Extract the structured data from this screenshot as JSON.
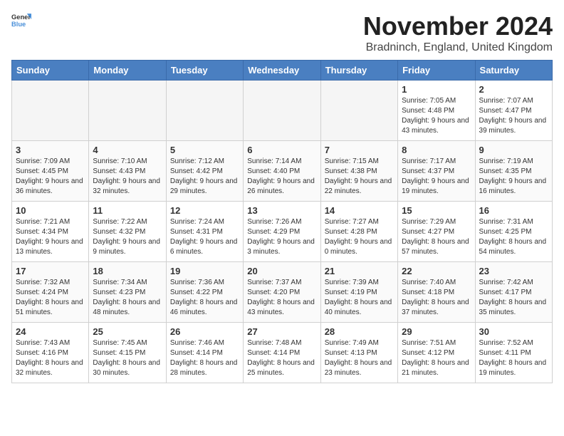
{
  "header": {
    "logo_general": "General",
    "logo_blue": "Blue",
    "month_title": "November 2024",
    "location": "Bradninch, England, United Kingdom"
  },
  "weekdays": [
    "Sunday",
    "Monday",
    "Tuesday",
    "Wednesday",
    "Thursday",
    "Friday",
    "Saturday"
  ],
  "weeks": [
    [
      {
        "day": "",
        "info": ""
      },
      {
        "day": "",
        "info": ""
      },
      {
        "day": "",
        "info": ""
      },
      {
        "day": "",
        "info": ""
      },
      {
        "day": "",
        "info": ""
      },
      {
        "day": "1",
        "info": "Sunrise: 7:05 AM\nSunset: 4:48 PM\nDaylight: 9 hours and 43 minutes."
      },
      {
        "day": "2",
        "info": "Sunrise: 7:07 AM\nSunset: 4:47 PM\nDaylight: 9 hours and 39 minutes."
      }
    ],
    [
      {
        "day": "3",
        "info": "Sunrise: 7:09 AM\nSunset: 4:45 PM\nDaylight: 9 hours and 36 minutes."
      },
      {
        "day": "4",
        "info": "Sunrise: 7:10 AM\nSunset: 4:43 PM\nDaylight: 9 hours and 32 minutes."
      },
      {
        "day": "5",
        "info": "Sunrise: 7:12 AM\nSunset: 4:42 PM\nDaylight: 9 hours and 29 minutes."
      },
      {
        "day": "6",
        "info": "Sunrise: 7:14 AM\nSunset: 4:40 PM\nDaylight: 9 hours and 26 minutes."
      },
      {
        "day": "7",
        "info": "Sunrise: 7:15 AM\nSunset: 4:38 PM\nDaylight: 9 hours and 22 minutes."
      },
      {
        "day": "8",
        "info": "Sunrise: 7:17 AM\nSunset: 4:37 PM\nDaylight: 9 hours and 19 minutes."
      },
      {
        "day": "9",
        "info": "Sunrise: 7:19 AM\nSunset: 4:35 PM\nDaylight: 9 hours and 16 minutes."
      }
    ],
    [
      {
        "day": "10",
        "info": "Sunrise: 7:21 AM\nSunset: 4:34 PM\nDaylight: 9 hours and 13 minutes."
      },
      {
        "day": "11",
        "info": "Sunrise: 7:22 AM\nSunset: 4:32 PM\nDaylight: 9 hours and 9 minutes."
      },
      {
        "day": "12",
        "info": "Sunrise: 7:24 AM\nSunset: 4:31 PM\nDaylight: 9 hours and 6 minutes."
      },
      {
        "day": "13",
        "info": "Sunrise: 7:26 AM\nSunset: 4:29 PM\nDaylight: 9 hours and 3 minutes."
      },
      {
        "day": "14",
        "info": "Sunrise: 7:27 AM\nSunset: 4:28 PM\nDaylight: 9 hours and 0 minutes."
      },
      {
        "day": "15",
        "info": "Sunrise: 7:29 AM\nSunset: 4:27 PM\nDaylight: 8 hours and 57 minutes."
      },
      {
        "day": "16",
        "info": "Sunrise: 7:31 AM\nSunset: 4:25 PM\nDaylight: 8 hours and 54 minutes."
      }
    ],
    [
      {
        "day": "17",
        "info": "Sunrise: 7:32 AM\nSunset: 4:24 PM\nDaylight: 8 hours and 51 minutes."
      },
      {
        "day": "18",
        "info": "Sunrise: 7:34 AM\nSunset: 4:23 PM\nDaylight: 8 hours and 48 minutes."
      },
      {
        "day": "19",
        "info": "Sunrise: 7:36 AM\nSunset: 4:22 PM\nDaylight: 8 hours and 46 minutes."
      },
      {
        "day": "20",
        "info": "Sunrise: 7:37 AM\nSunset: 4:20 PM\nDaylight: 8 hours and 43 minutes."
      },
      {
        "day": "21",
        "info": "Sunrise: 7:39 AM\nSunset: 4:19 PM\nDaylight: 8 hours and 40 minutes."
      },
      {
        "day": "22",
        "info": "Sunrise: 7:40 AM\nSunset: 4:18 PM\nDaylight: 8 hours and 37 minutes."
      },
      {
        "day": "23",
        "info": "Sunrise: 7:42 AM\nSunset: 4:17 PM\nDaylight: 8 hours and 35 minutes."
      }
    ],
    [
      {
        "day": "24",
        "info": "Sunrise: 7:43 AM\nSunset: 4:16 PM\nDaylight: 8 hours and 32 minutes."
      },
      {
        "day": "25",
        "info": "Sunrise: 7:45 AM\nSunset: 4:15 PM\nDaylight: 8 hours and 30 minutes."
      },
      {
        "day": "26",
        "info": "Sunrise: 7:46 AM\nSunset: 4:14 PM\nDaylight: 8 hours and 28 minutes."
      },
      {
        "day": "27",
        "info": "Sunrise: 7:48 AM\nSunset: 4:14 PM\nDaylight: 8 hours and 25 minutes."
      },
      {
        "day": "28",
        "info": "Sunrise: 7:49 AM\nSunset: 4:13 PM\nDaylight: 8 hours and 23 minutes."
      },
      {
        "day": "29",
        "info": "Sunrise: 7:51 AM\nSunset: 4:12 PM\nDaylight: 8 hours and 21 minutes."
      },
      {
        "day": "30",
        "info": "Sunrise: 7:52 AM\nSunset: 4:11 PM\nDaylight: 8 hours and 19 minutes."
      }
    ]
  ]
}
